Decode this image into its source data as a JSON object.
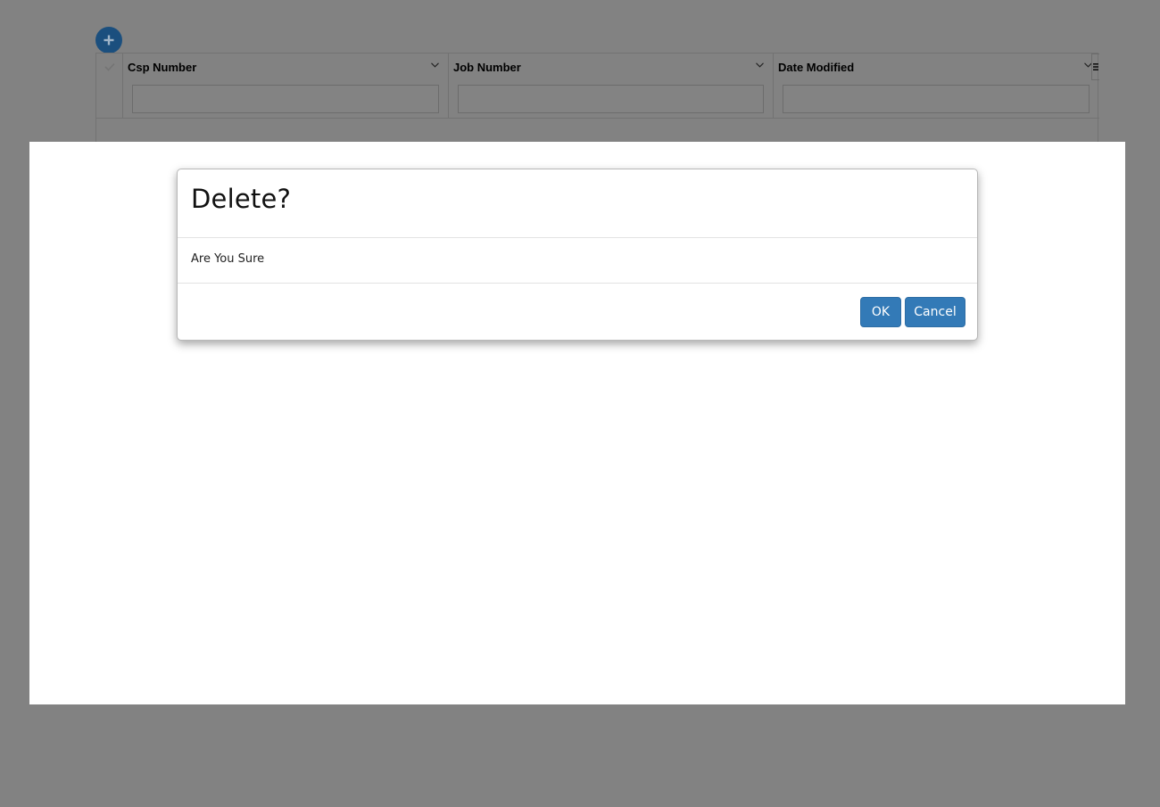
{
  "toolbar": {
    "add_icon": "plus-icon"
  },
  "grid": {
    "columns": [
      {
        "label": "Csp Number",
        "filter_value": ""
      },
      {
        "label": "Job Number",
        "filter_value": ""
      },
      {
        "label": "Date Modified",
        "filter_value": ""
      }
    ],
    "select_icon": "check-icon",
    "sort_icon": "chevron-down-icon",
    "menu_icon": "menu-icon"
  },
  "dialog": {
    "title": "Delete?",
    "message": "Are You Sure",
    "ok_label": "OK",
    "cancel_label": "Cancel"
  },
  "colors": {
    "overlay": "#828282",
    "primary_button": "#337ab7",
    "add_button": "#1b4f7e"
  }
}
